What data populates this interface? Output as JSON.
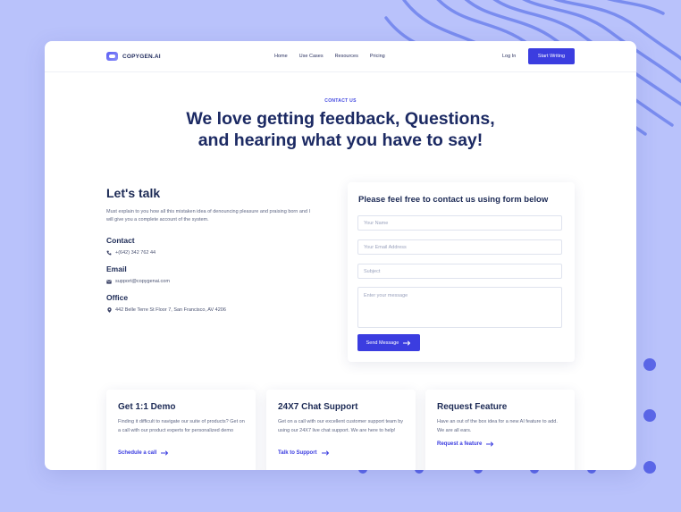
{
  "brand": {
    "name": "COPYGEN.AI"
  },
  "nav": {
    "links": [
      "Home",
      "Use Cases",
      "Resources",
      "Pricing"
    ],
    "login": "Log In",
    "cta": "Start Writing"
  },
  "hero": {
    "eyebrow": "CONTACT US",
    "headline_line1": "We love getting feedback, Questions,",
    "headline_line2": "and hearing what you have to say!"
  },
  "talk": {
    "title": "Let's talk",
    "description": "Must explain to you how all this mistaken idea of denouncing pleasure and praising born and I will give you a complete account of the system.",
    "contact_label": "Contact",
    "phone": "+(642) 342 762 44",
    "email_label": "Email",
    "email": "support@copygenai.com",
    "office_label": "Office",
    "address": "442 Belle Terre St Floor 7, San Francisco, AV 4206"
  },
  "form": {
    "title": "Please feel free to contact us using form below",
    "name_placeholder": "Your Name",
    "email_placeholder": "Your Email Address",
    "subject_placeholder": "Subject",
    "message_placeholder": "Enter your message",
    "submit": "Send Message"
  },
  "features": [
    {
      "title": "Get 1:1 Demo",
      "description": "Finding it difficult to navigate our suite of products? Get on a call with our product experts for personalized demo",
      "link": "Schedule a call"
    },
    {
      "title": "24X7 Chat Support",
      "description": "Get on a call with our excellent customer support team by using our 24X7 live chat support. We are here to help!",
      "link": "Talk to Support"
    },
    {
      "title": "Request Feature",
      "description": "Have an out of the box idea for a new AI feature to add. We are all ears.",
      "link": "Request a feature"
    }
  ],
  "colors": {
    "background": "#b9c2fb",
    "accent": "#3b3de0",
    "heading": "#1c2a63"
  },
  "icons": [
    "phone-icon",
    "mail-icon",
    "location-pin-icon",
    "arrow-right-icon"
  ]
}
